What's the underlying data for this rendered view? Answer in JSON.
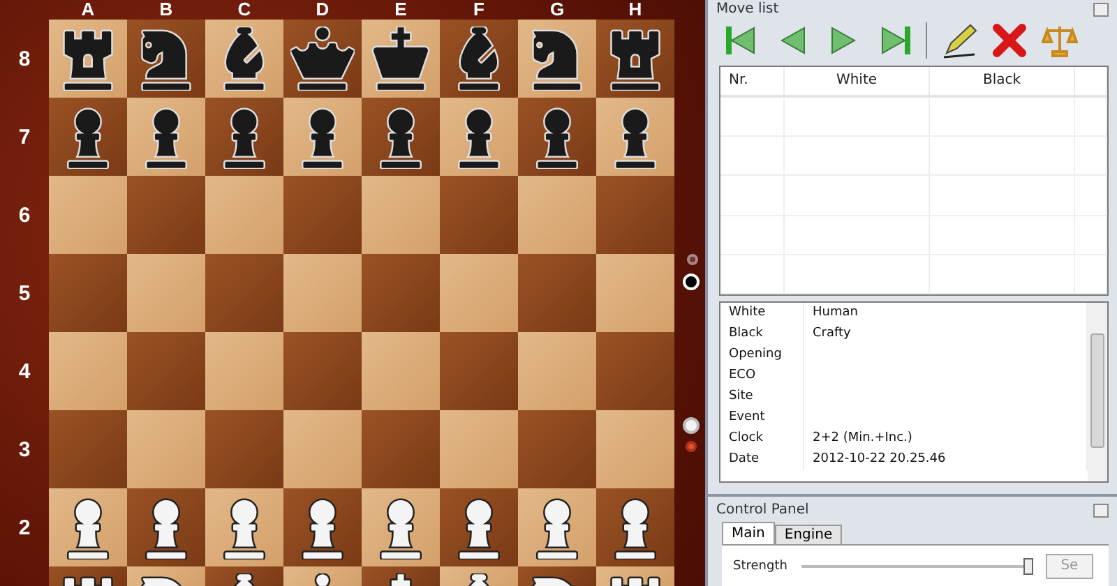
{
  "board": {
    "files": [
      "A",
      "B",
      "C",
      "D",
      "E",
      "F",
      "G",
      "H"
    ],
    "ranks": [
      {
        "label": "8",
        "squares": [
          {
            "kind": "rook",
            "color": "#1a1a1a"
          },
          {
            "kind": "knight",
            "color": "#1a1a1a"
          },
          {
            "kind": "bishop",
            "color": "#1a1a1a"
          },
          {
            "kind": "queen",
            "color": "#1a1a1a"
          },
          {
            "kind": "king",
            "color": "#1a1a1a"
          },
          {
            "kind": "bishop",
            "color": "#1a1a1a"
          },
          {
            "kind": "knight",
            "color": "#1a1a1a"
          },
          {
            "kind": "rook",
            "color": "#1a1a1a"
          }
        ]
      },
      {
        "label": "7",
        "squares": [
          {
            "kind": "pawn",
            "color": "#1a1a1a"
          },
          {
            "kind": "pawn",
            "color": "#1a1a1a"
          },
          {
            "kind": "pawn",
            "color": "#1a1a1a"
          },
          {
            "kind": "pawn",
            "color": "#1a1a1a"
          },
          {
            "kind": "pawn",
            "color": "#1a1a1a"
          },
          {
            "kind": "pawn",
            "color": "#1a1a1a"
          },
          {
            "kind": "pawn",
            "color": "#1a1a1a"
          },
          {
            "kind": "pawn",
            "color": "#1a1a1a"
          }
        ]
      },
      {
        "label": "6"
      },
      {
        "label": "5"
      },
      {
        "label": "4"
      },
      {
        "label": "3"
      },
      {
        "label": "2",
        "squares": [
          {
            "kind": "pawn",
            "color": "#f4f4f4"
          },
          {
            "kind": "pawn",
            "color": "#f4f4f4"
          },
          {
            "kind": "pawn",
            "color": "#f4f4f4"
          },
          {
            "kind": "pawn",
            "color": "#f4f4f4"
          },
          {
            "kind": "pawn",
            "color": "#f4f4f4"
          },
          {
            "kind": "pawn",
            "color": "#f4f4f4"
          },
          {
            "kind": "pawn",
            "color": "#f4f4f4"
          },
          {
            "kind": "pawn",
            "color": "#f4f4f4"
          }
        ]
      },
      {
        "squares": [
          {
            "kind": "rook",
            "color": "#f4f4f4"
          },
          {
            "kind": "knight",
            "color": "#f4f4f4"
          },
          {
            "kind": "bishop",
            "color": "#f4f4f4"
          },
          {
            "kind": "queen",
            "color": "#f4f4f4"
          },
          {
            "kind": "king",
            "color": "#f4f4f4"
          },
          {
            "kind": "bishop",
            "color": "#f4f4f4"
          },
          {
            "kind": "knight",
            "color": "#f4f4f4"
          },
          {
            "kind": "rook",
            "color": "#f4f4f4"
          }
        ]
      }
    ]
  },
  "move_list": {
    "title": "Move list",
    "columns": [
      "Nr.",
      "White",
      "Black"
    ]
  },
  "game_info": [
    {
      "label": "White",
      "value": "Human"
    },
    {
      "label": "Black",
      "value": "Crafty"
    },
    {
      "label": "Opening"
    },
    {
      "label": "ECO"
    },
    {
      "label": "Site"
    },
    {
      "label": "Event"
    },
    {
      "label": "Clock",
      "value": "2+2 (Min.+Inc.)"
    },
    {
      "label": "Date",
      "value": "2012-10-22 20.25.46"
    }
  ],
  "control_panel": {
    "title": "Control Panel",
    "tabs": [
      {
        "label": "Main",
        "selected": true
      },
      {
        "label": "Engine",
        "selected": false
      }
    ],
    "strength": {
      "label": "Strength",
      "level": 0.98
    },
    "button": "Se"
  }
}
